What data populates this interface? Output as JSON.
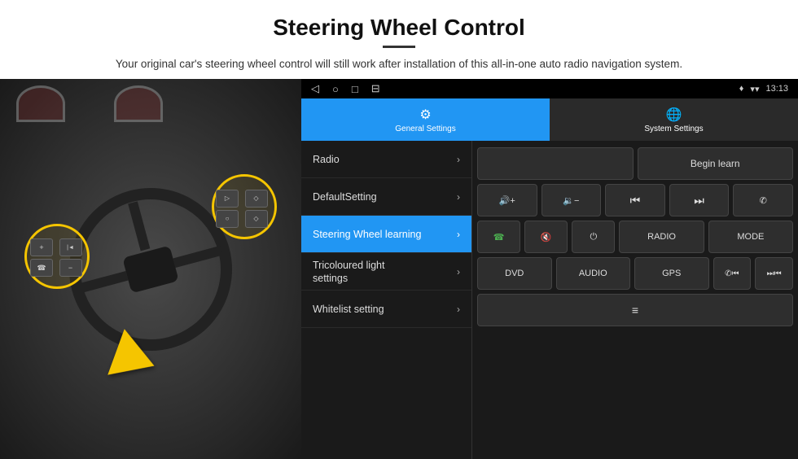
{
  "header": {
    "title": "Steering Wheel Control",
    "description": "Your original car's steering wheel control will still work after installation of this all-in-one auto radio navigation system."
  },
  "statusbar": {
    "nav_back": "◁",
    "nav_home": "○",
    "nav_square": "□",
    "nav_menu": "⊟",
    "signal_icon": "▾",
    "wifi_icon": "▾",
    "time": "13:13",
    "location_icon": "♦"
  },
  "tabs": [
    {
      "id": "general",
      "label": "General Settings",
      "active": true
    },
    {
      "id": "system",
      "label": "System Settings",
      "active": false
    }
  ],
  "menu_items": [
    {
      "id": "radio",
      "label": "Radio",
      "active": false
    },
    {
      "id": "default",
      "label": "DefaultSetting",
      "active": false
    },
    {
      "id": "steering",
      "label": "Steering Wheel learning",
      "active": true
    },
    {
      "id": "tricoloured",
      "label": "Tricoloured light\nsettings",
      "active": false,
      "multiline": true
    },
    {
      "id": "whitelist",
      "label": "Whitelist setting",
      "active": false
    }
  ],
  "controls": {
    "begin_learn": "Begin learn",
    "row1": [
      {
        "id": "vol-up",
        "symbol": "🔊+",
        "text": "◄◄+"
      },
      {
        "id": "vol-down",
        "symbol": "🔉-",
        "text": "◄◄-"
      },
      {
        "id": "prev-track",
        "symbol": "⏮",
        "text": "⏮"
      },
      {
        "id": "next-track",
        "symbol": "⏭",
        "text": "⏭"
      },
      {
        "id": "phone",
        "symbol": "✆",
        "text": "✆"
      }
    ],
    "row2": [
      {
        "id": "answer",
        "symbol": "☎",
        "text": "☎"
      },
      {
        "id": "mute",
        "symbol": "🔇x",
        "text": "🔇"
      },
      {
        "id": "power",
        "symbol": "⏻",
        "text": "⏻"
      },
      {
        "id": "radio-btn",
        "symbol": "RADIO",
        "text": "RADIO"
      },
      {
        "id": "mode",
        "symbol": "MODE",
        "text": "MODE"
      }
    ],
    "row3": [
      {
        "id": "dvd",
        "symbol": "DVD",
        "text": "DVD"
      },
      {
        "id": "audio",
        "symbol": "AUDIO",
        "text": "AUDIO"
      },
      {
        "id": "gps",
        "symbol": "GPS",
        "text": "GPS"
      },
      {
        "id": "tel-prev",
        "symbol": "✆⏮",
        "text": "✆⏮"
      },
      {
        "id": "next-prev",
        "symbol": "⏭⏮",
        "text": "⏭⏮"
      }
    ],
    "row4": [
      {
        "id": "list",
        "symbol": "≡",
        "text": "≡"
      }
    ]
  }
}
